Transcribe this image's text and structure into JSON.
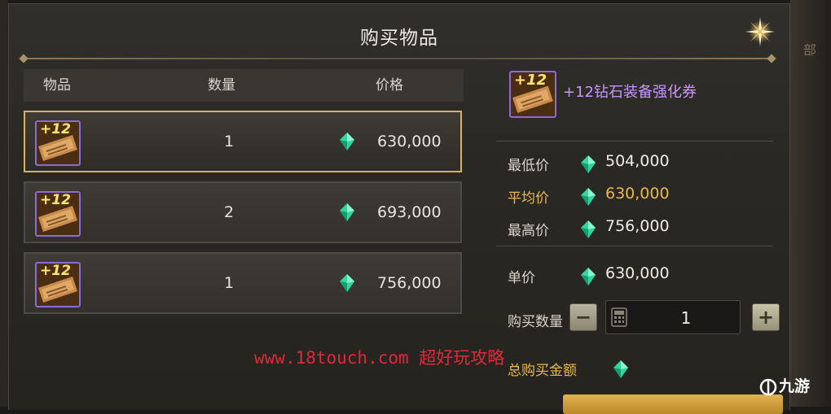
{
  "dialog": {
    "title": "购买物品"
  },
  "table": {
    "headers": {
      "item": "物品",
      "qty": "数量",
      "price": "价格"
    },
    "rows": [
      {
        "badge": "+12",
        "qty": "1",
        "price": "630,000",
        "selected": true
      },
      {
        "badge": "+12",
        "qty": "2",
        "price": "693,000",
        "selected": false
      },
      {
        "badge": "+12",
        "qty": "1",
        "price": "756,000",
        "selected": false
      }
    ]
  },
  "details": {
    "item_badge": "+12",
    "item_name": "+12钻石装备强化券",
    "lowest_label": "最低价",
    "lowest_value": "504,000",
    "average_label": "平均价",
    "average_value": "630,000",
    "highest_label": "最高价",
    "highest_value": "756,000",
    "unit_price_label": "单价",
    "unit_price_value": "630,000",
    "quantity_label": "购买数量",
    "quantity_value": "1",
    "total_label": "总购买金额"
  },
  "overlay": {
    "watermark": "www.18touch.com 超好玩攻略",
    "site_logo": "九游",
    "bg_side_label": "部"
  },
  "colors": {
    "accent_gold": "#e8b84a",
    "item_purple": "#c794ff",
    "selected_border": "#d4b35a",
    "gem": "#2fd6a0",
    "watermark": "#e0283c"
  },
  "icons": {
    "close": "close-star-icon",
    "currency": "diamond-gem-icon",
    "item": "enhancement-ticket-icon",
    "quantity": "calculator-icon"
  }
}
